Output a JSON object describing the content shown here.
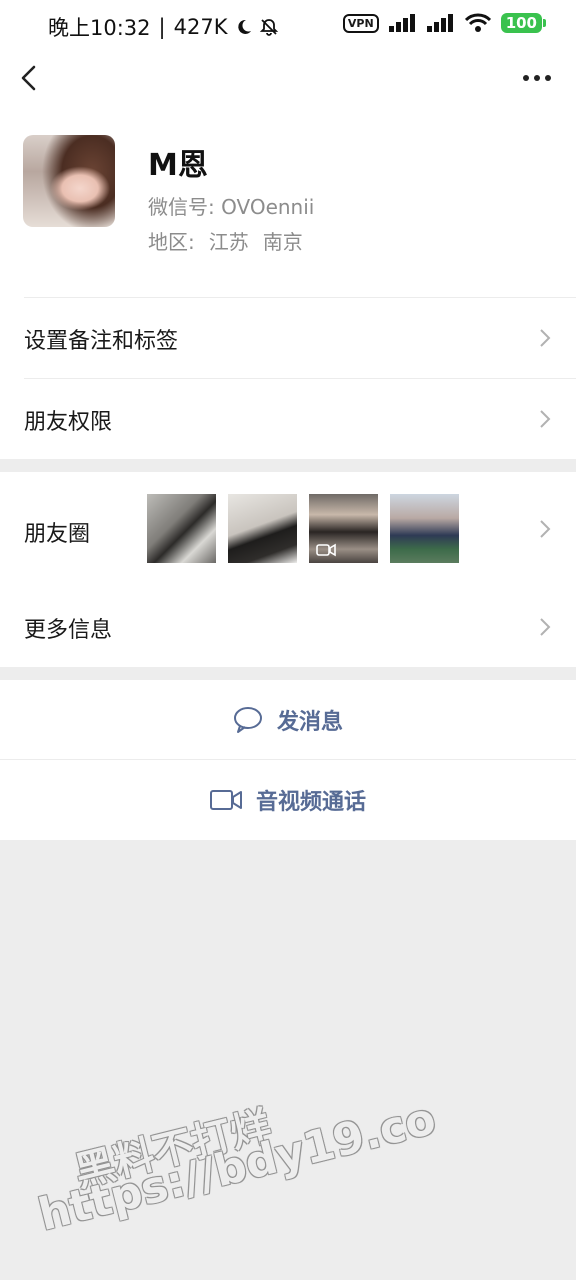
{
  "status_bar": {
    "time": "晚上10:32",
    "network_speed": "427K",
    "vpn_label": "VPN",
    "battery": "100",
    "icons": [
      "moon-icon",
      "bell-off-icon",
      "signal-icon",
      "signal-icon",
      "wifi-icon"
    ]
  },
  "nav": {
    "back_icon": "chevron-left-icon",
    "more_icon": "more-dots-icon"
  },
  "profile": {
    "name": "M恩",
    "wechat_id_label": "微信号:",
    "wechat_id": "OVOennii",
    "region_label": "地区:",
    "region_province": "江苏",
    "region_city": "南京"
  },
  "rows": {
    "remark": "设置备注和标签",
    "permissions": "朋友权限",
    "moments": "朋友圈",
    "more_info": "更多信息"
  },
  "actions": {
    "message": "发消息",
    "video_call": "音视频通话"
  },
  "watermark": {
    "line1": "黑料不打烊",
    "line2": "https://bdy19.co"
  },
  "colors": {
    "link_blue": "#576b95",
    "background": "#ededed",
    "battery_green": "#3ac24e"
  }
}
